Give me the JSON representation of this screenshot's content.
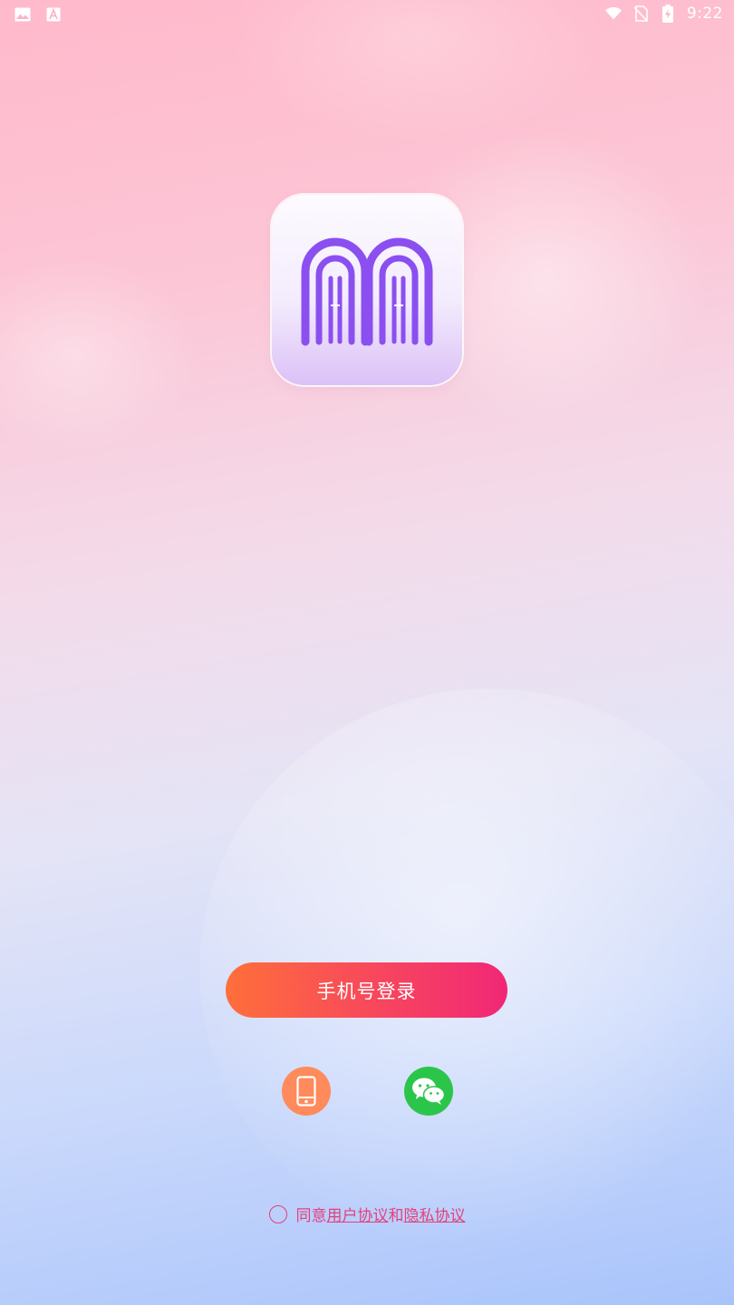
{
  "status_bar": {
    "time": "9:22",
    "left_icons": [
      "image-icon",
      "font-a-icon"
    ],
    "right_icons": [
      "wifi-icon",
      "no-sim-icon",
      "battery-charging-icon"
    ]
  },
  "logo": {
    "icon": "app-logo-mm-icon"
  },
  "login": {
    "phone_button_label": "手机号登录",
    "alt_options": [
      {
        "icon": "mobile-phone-icon",
        "color": "#ff8a5b"
      },
      {
        "icon": "wechat-icon",
        "color": "#2bc54a"
      }
    ]
  },
  "agreement": {
    "prefix": "同意",
    "user_agreement": "用户协议",
    "conjunction": "和",
    "privacy_policy": "隐私协议",
    "checked": false
  },
  "colors": {
    "accent": "#e2417d",
    "button_start": "#ff6f3a",
    "button_end": "#f12776",
    "logo_purple": "#8b4ff0"
  }
}
